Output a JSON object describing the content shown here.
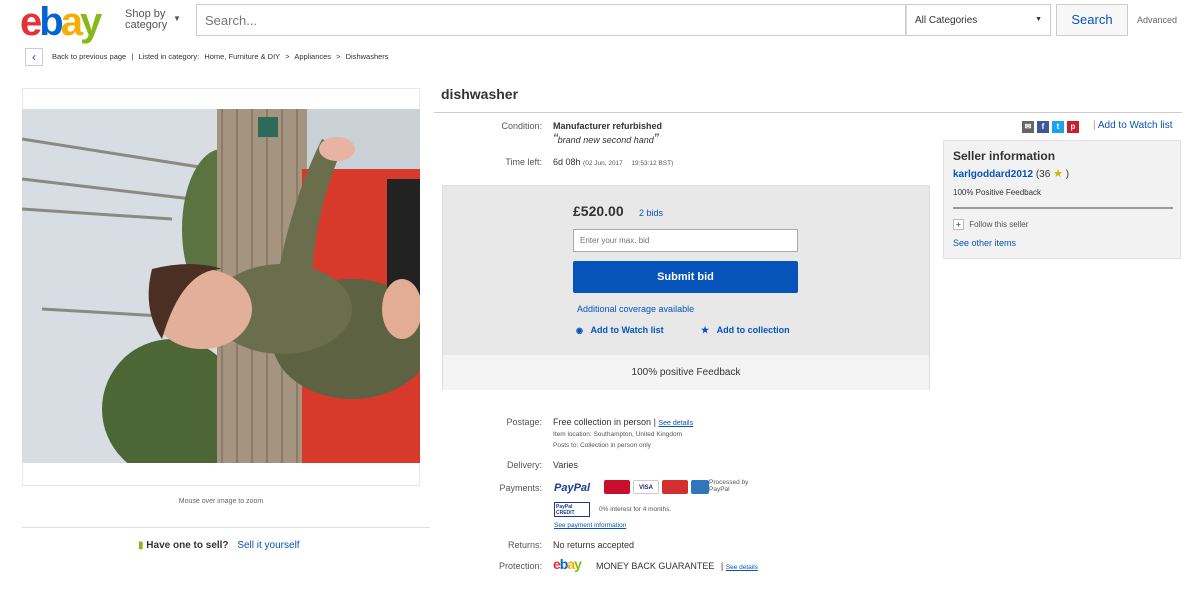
{
  "header": {
    "logo_letters": [
      "e",
      "b",
      "a",
      "y"
    ],
    "shop_by_line1": "Shop by",
    "shop_by_line2": "category",
    "search_placeholder": "Search...",
    "category_select": "All Categories",
    "search_button": "Search",
    "advanced_link": "Advanced"
  },
  "breadcrumb": {
    "back": "Back to previous page",
    "separator": "|",
    "listed_in": "Listed in category:",
    "path": [
      "Home, Furniture & DIY",
      ">",
      "Appliances",
      ">",
      "Dishwashers"
    ]
  },
  "gallery": {
    "zoom_hint": "Mouse over image to zoom",
    "sell_question": "Have one to sell?",
    "sell_link": "Sell it yourself"
  },
  "listing": {
    "title": "dishwasher",
    "condition_label": "Condition:",
    "condition_value": "Manufacturer refurbished",
    "condition_note": "brand new second hand",
    "time_left_label": "Time left:",
    "time_left_value": "6d 08h",
    "time_left_date": "(02 Jun, 2017",
    "time_left_time": "19:53:12 BST)",
    "price": "£520.00",
    "bids": "2 bids",
    "bid_placeholder": "Enter your max. bid",
    "submit_bid": "Submit bid",
    "additional_coverage": "Additional coverage available",
    "add_watch": "Add to Watch list",
    "add_collection": "Add to collection",
    "positive_feedback": "100% positive Feedback"
  },
  "shipping": {
    "postage_label": "Postage:",
    "postage_value": "Free collection in person",
    "postage_sep": "|",
    "see_details": "See details",
    "item_location": "Item location:  Southampton, United Kingdom",
    "posts_to": "Posts to:  Collection in person only",
    "delivery_label": "Delivery:",
    "delivery_value": "Varies",
    "payments_label": "Payments:",
    "paypal": "PayPal",
    "cards": [
      "",
      "VISA",
      "",
      ""
    ],
    "processed_by": "Processed by PayPal",
    "paypal_credit": "PayPal CREDIT",
    "interest": "0% interest for 4 months.",
    "see_payment": "See payment information",
    "returns_label": "Returns:",
    "returns_value": "No returns accepted",
    "protection_label": "Protection:",
    "money_back": "MONEY BACK GUARANTEE",
    "protection_sep": "|",
    "see_details2": "See details"
  },
  "seller": {
    "watch_list_link": "Add to Watch list",
    "watch_sep": "|",
    "heading": "Seller information",
    "username": "karlgoddard2012",
    "score": "(36",
    "score_close": ")",
    "feedback": "100% Positive Feedback",
    "follow": "Follow this seller",
    "see_other": "See other items"
  },
  "colors": {
    "ebay_red": "#e53238",
    "ebay_blue": "#0064d2",
    "ebay_yellow": "#f5af02",
    "ebay_green": "#86b817",
    "link_blue": "#0654ba"
  }
}
